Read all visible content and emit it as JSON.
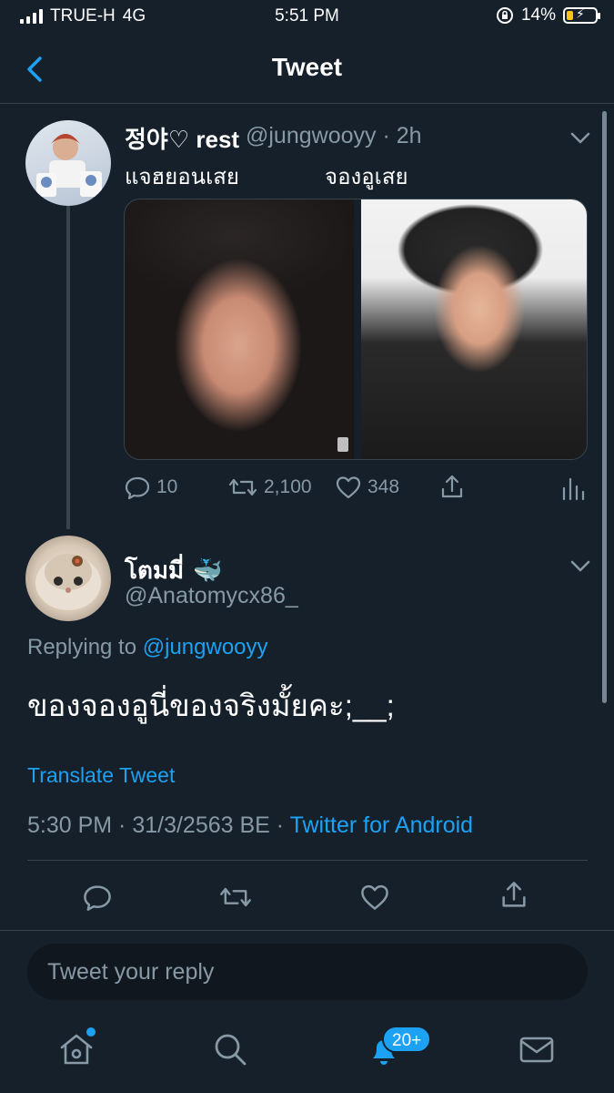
{
  "status_bar": {
    "carrier": "TRUE-H",
    "network": "4G",
    "time": "5:51 PM",
    "battery": "14%"
  },
  "header": {
    "title": "Tweet"
  },
  "original_tweet": {
    "display_name": "정야♡ rest",
    "meta": "@jungwooyy · 2h",
    "text_left": "แจฮยอนเสย",
    "text_right": "จองอูเสย",
    "replies": "10",
    "retweets": "2,100",
    "likes": "348"
  },
  "reply_tweet": {
    "display_name": "โตมมี่",
    "name_emoji": "🐳",
    "handle": "@Anatomycx86_",
    "replying_prefix": "Replying to ",
    "replying_mention": "@jungwooyy",
    "text": "ของจองอูนี่ของจริงมั้ยคะ;__;",
    "translate_label": "Translate Tweet",
    "timestamp": "5:30 PM · 31/3/2563 BE · ",
    "source": "Twitter for Android"
  },
  "composer": {
    "placeholder": "Tweet your reply"
  },
  "tab_bar": {
    "notifications_badge": "20+"
  },
  "colors": {
    "background": "#15202b",
    "accent": "#1da1f2",
    "muted": "#8899a6",
    "divider": "#38444d"
  },
  "icons": [
    "back-arrow-icon",
    "chevron-down-icon",
    "reply-icon",
    "retweet-icon",
    "like-icon",
    "share-icon",
    "analytics-icon",
    "home-icon",
    "search-icon",
    "notifications-icon",
    "messages-icon"
  ]
}
